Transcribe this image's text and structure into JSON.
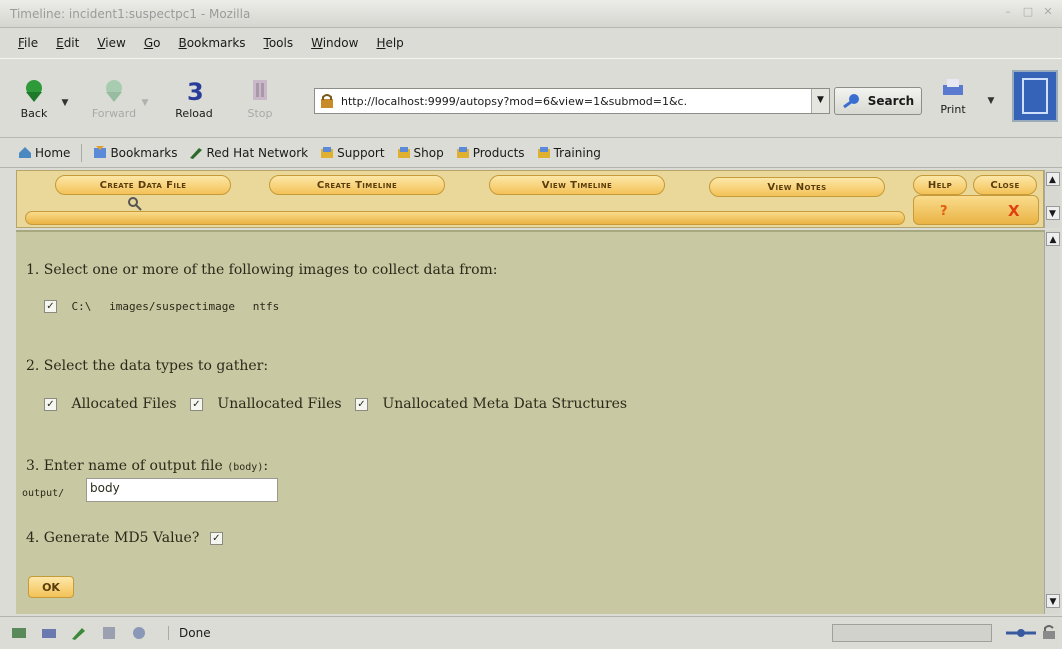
{
  "window": {
    "title": "Timeline: incident1:suspectpc1 - Mozilla"
  },
  "menu": [
    "File",
    "Edit",
    "View",
    "Go",
    "Bookmarks",
    "Tools",
    "Window",
    "Help"
  ],
  "nav": {
    "back": "Back",
    "forward": "Forward",
    "reload": "Reload",
    "stop": "Stop",
    "url": "http://localhost:9999/autopsy?mod=6&view=1&submod=1&c.",
    "search": "Search",
    "print": "Print"
  },
  "bookmarks": [
    "Home",
    "Bookmarks",
    "Red Hat Network",
    "Support",
    "Shop",
    "Products",
    "Training"
  ],
  "autopsy_tabs": {
    "create_data_file": "Create Data File",
    "create_timeline": "Create Timeline",
    "view_timeline": "View Timeline",
    "view_notes": "View Notes",
    "help": "Help",
    "close": "Close",
    "help_symbol": "?",
    "close_symbol": "X"
  },
  "form": {
    "step1": "1. Select one or more of the following images to collect data from:",
    "image": {
      "mount": "C:\\",
      "path": "images/suspectimage",
      "fs": "ntfs",
      "checked": true
    },
    "step2": "2. Select the data types to gather:",
    "types": [
      {
        "label": "Allocated Files",
        "checked": true
      },
      {
        "label": "Unallocated Files",
        "checked": true
      },
      {
        "label": "Unallocated Meta Data Structures",
        "checked": true
      }
    ],
    "step3": "3. Enter name of output file",
    "step3_hint": "(body)",
    "step3_colon": ":",
    "output_prefix": "output/",
    "output_value": "body",
    "step4": "4. Generate MD5 Value?",
    "md5_checked": true,
    "ok": "OK"
  },
  "status": {
    "text": "Done"
  },
  "colors": {
    "toolbar_bg": "#e9d89a",
    "content_bg": "#c8c8a2",
    "tab_gold": "#f4c258"
  }
}
